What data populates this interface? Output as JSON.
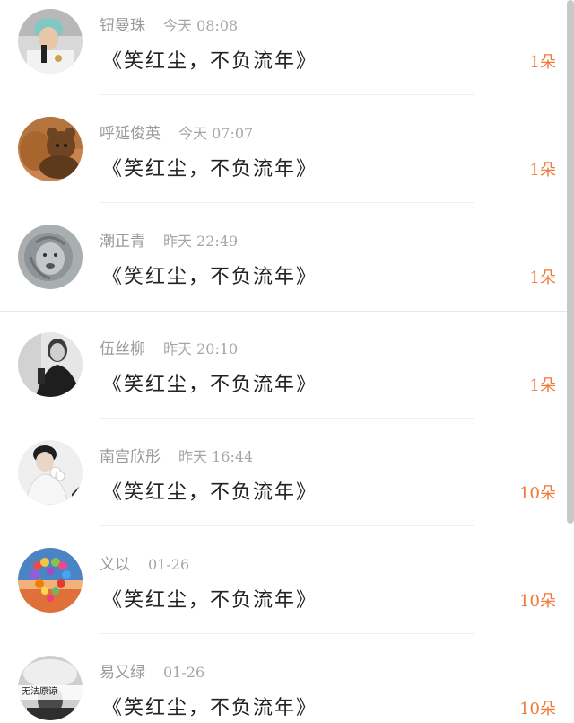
{
  "records": [
    {
      "name": "钮曼珠",
      "time": "今天 08:08",
      "gift": "《笑红尘，不负流年》",
      "count": "1朵",
      "avatar_icon": "singer-avatar"
    },
    {
      "name": "呼延俊英",
      "time": "今天 07:07",
      "gift": "《笑红尘，不负流年》",
      "count": "1朵",
      "avatar_icon": "teddy-bear-avatar"
    },
    {
      "name": "潮正青",
      "time": "昨天 22:49",
      "gift": "《笑红尘，不负流年》",
      "count": "1朵",
      "avatar_icon": "lion-avatar"
    },
    {
      "name": "伍丝柳",
      "time": "昨天 20:10",
      "gift": "《笑红尘，不负流年》",
      "count": "1朵",
      "avatar_icon": "dark-portrait-avatar"
    },
    {
      "name": "南宫欣彤",
      "time": "昨天 16:44",
      "gift": "《笑红尘，不负流年》",
      "count": "10朵",
      "avatar_icon": "man-with-flower-avatar"
    },
    {
      "name": "义以",
      "time": "01-26",
      "gift": "《笑红尘，不负流年》",
      "count": "10朵",
      "avatar_icon": "heart-balloons-avatar"
    },
    {
      "name": "易又绿",
      "time": "01-26",
      "gift": "《笑红尘，不负流年》",
      "count": "10朵",
      "avatar_icon": "smoke-portrait-avatar",
      "avatar_caption": "无法原谅"
    }
  ],
  "colors": {
    "accent": "#f07a3a",
    "name_gray": "#9a9a9a",
    "title_text": "#222222",
    "divider": "#efefef"
  }
}
